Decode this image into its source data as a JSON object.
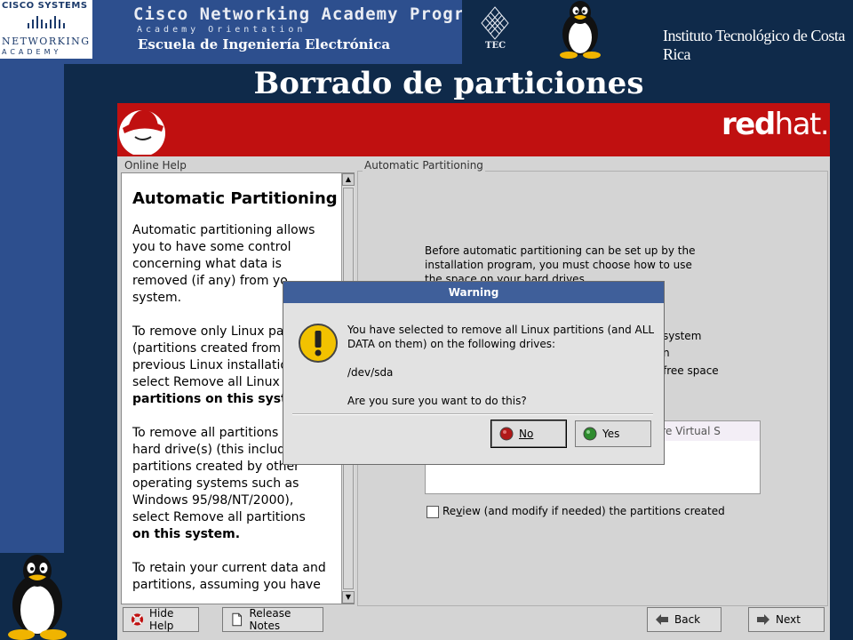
{
  "slide": {
    "cisco_brand": "CISCO SYSTEMS",
    "cisco_networking": "NETWORKING",
    "cisco_academy": "ACADEMY",
    "program_title": "Cisco Networking Academy Program",
    "program_subtitle": "Academy Orientation",
    "school": "Escuela de Ingeniería Electrónica",
    "tec_label": "TEC",
    "institution": "Instituto Tecnológico de Costa Rica",
    "title": "Borrado de particiones"
  },
  "installer": {
    "brand_red": "red",
    "brand_hat": "hat.",
    "online_help_label": "Online Help",
    "help": {
      "heading": "Automatic Partitioning",
      "paragraphs": [
        [
          "Automatic partitioning allows",
          "you to have some control",
          "concerning what data is",
          "removed (if any) from yo",
          "system."
        ],
        [
          "To remove only Linux pa",
          "(partitions created from a",
          "previous Linux installatio",
          "select Remove all Linux",
          "partitions on this syste"
        ],
        [
          "To remove all partitions",
          "hard drive(s) (this includ",
          "partitions created by other",
          "operating systems such as",
          "Windows 95/98/NT/2000),",
          "select Remove all partitions",
          "on this system."
        ],
        [
          "To retain your current data and",
          "partitions, assuming you have"
        ]
      ]
    },
    "auto_label": "Automatic Partitioning",
    "auto_description": "Before automatic partitioning can be set up by the installation program, you must choose how to use the space on your hard drives.",
    "option_fragments": [
      "system",
      "n",
      "free space"
    ],
    "drive_fragment": "are Virtual S",
    "review_label_pre": "Re",
    "review_label_key": "v",
    "review_label_post": "iew (and modify if needed) the partitions created",
    "buttons": {
      "hide_help": "Hide Help",
      "release_notes": "Release Notes",
      "back": "Back",
      "next": "Next"
    }
  },
  "dialog": {
    "title": "Warning",
    "message": "You have selected to remove all Linux partitions (and ALL DATA on them) on the following drives:",
    "drive": "/dev/sda",
    "question": "Are you sure you want to do this?",
    "no": "No",
    "yes": "Yes"
  },
  "colors": {
    "slide_bg": "#0f2a4a",
    "banner_blue": "#2d4f8e",
    "redhat_red": "#c01010",
    "dialog_title": "#3f5f9a"
  }
}
